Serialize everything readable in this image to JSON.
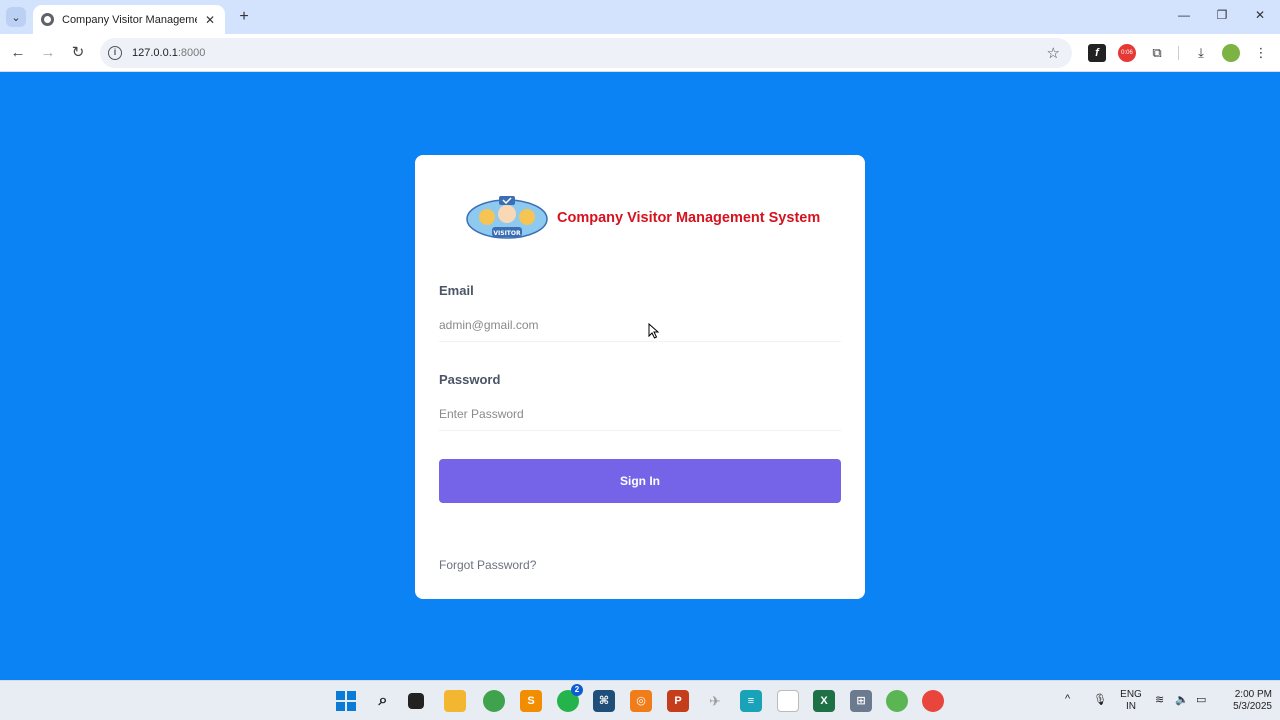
{
  "browser": {
    "tab_title": "Company Visitor Management",
    "url_host": "127.0.0.1",
    "url_port": ":8000"
  },
  "login": {
    "brand_name": "Company Visitor Management System",
    "logo_text": "VISITOR",
    "email_label": "Email",
    "email_placeholder": "admin@gmail.com",
    "password_label": "Password",
    "password_placeholder": "Enter Password",
    "signin_label": "Sign In",
    "forgot_label": "Forgot Password?"
  },
  "extensions": {
    "timer_badge": "0:06"
  },
  "taskbar": {
    "whatsapp_badge": "2",
    "language_top": "ENG",
    "language_bottom": "IN",
    "time": "2:00 PM",
    "date": "5/3/2025"
  },
  "colors": {
    "page_background": "#0b83f5",
    "brand_red": "#d6121f",
    "signin_purple": "#7564e8"
  }
}
